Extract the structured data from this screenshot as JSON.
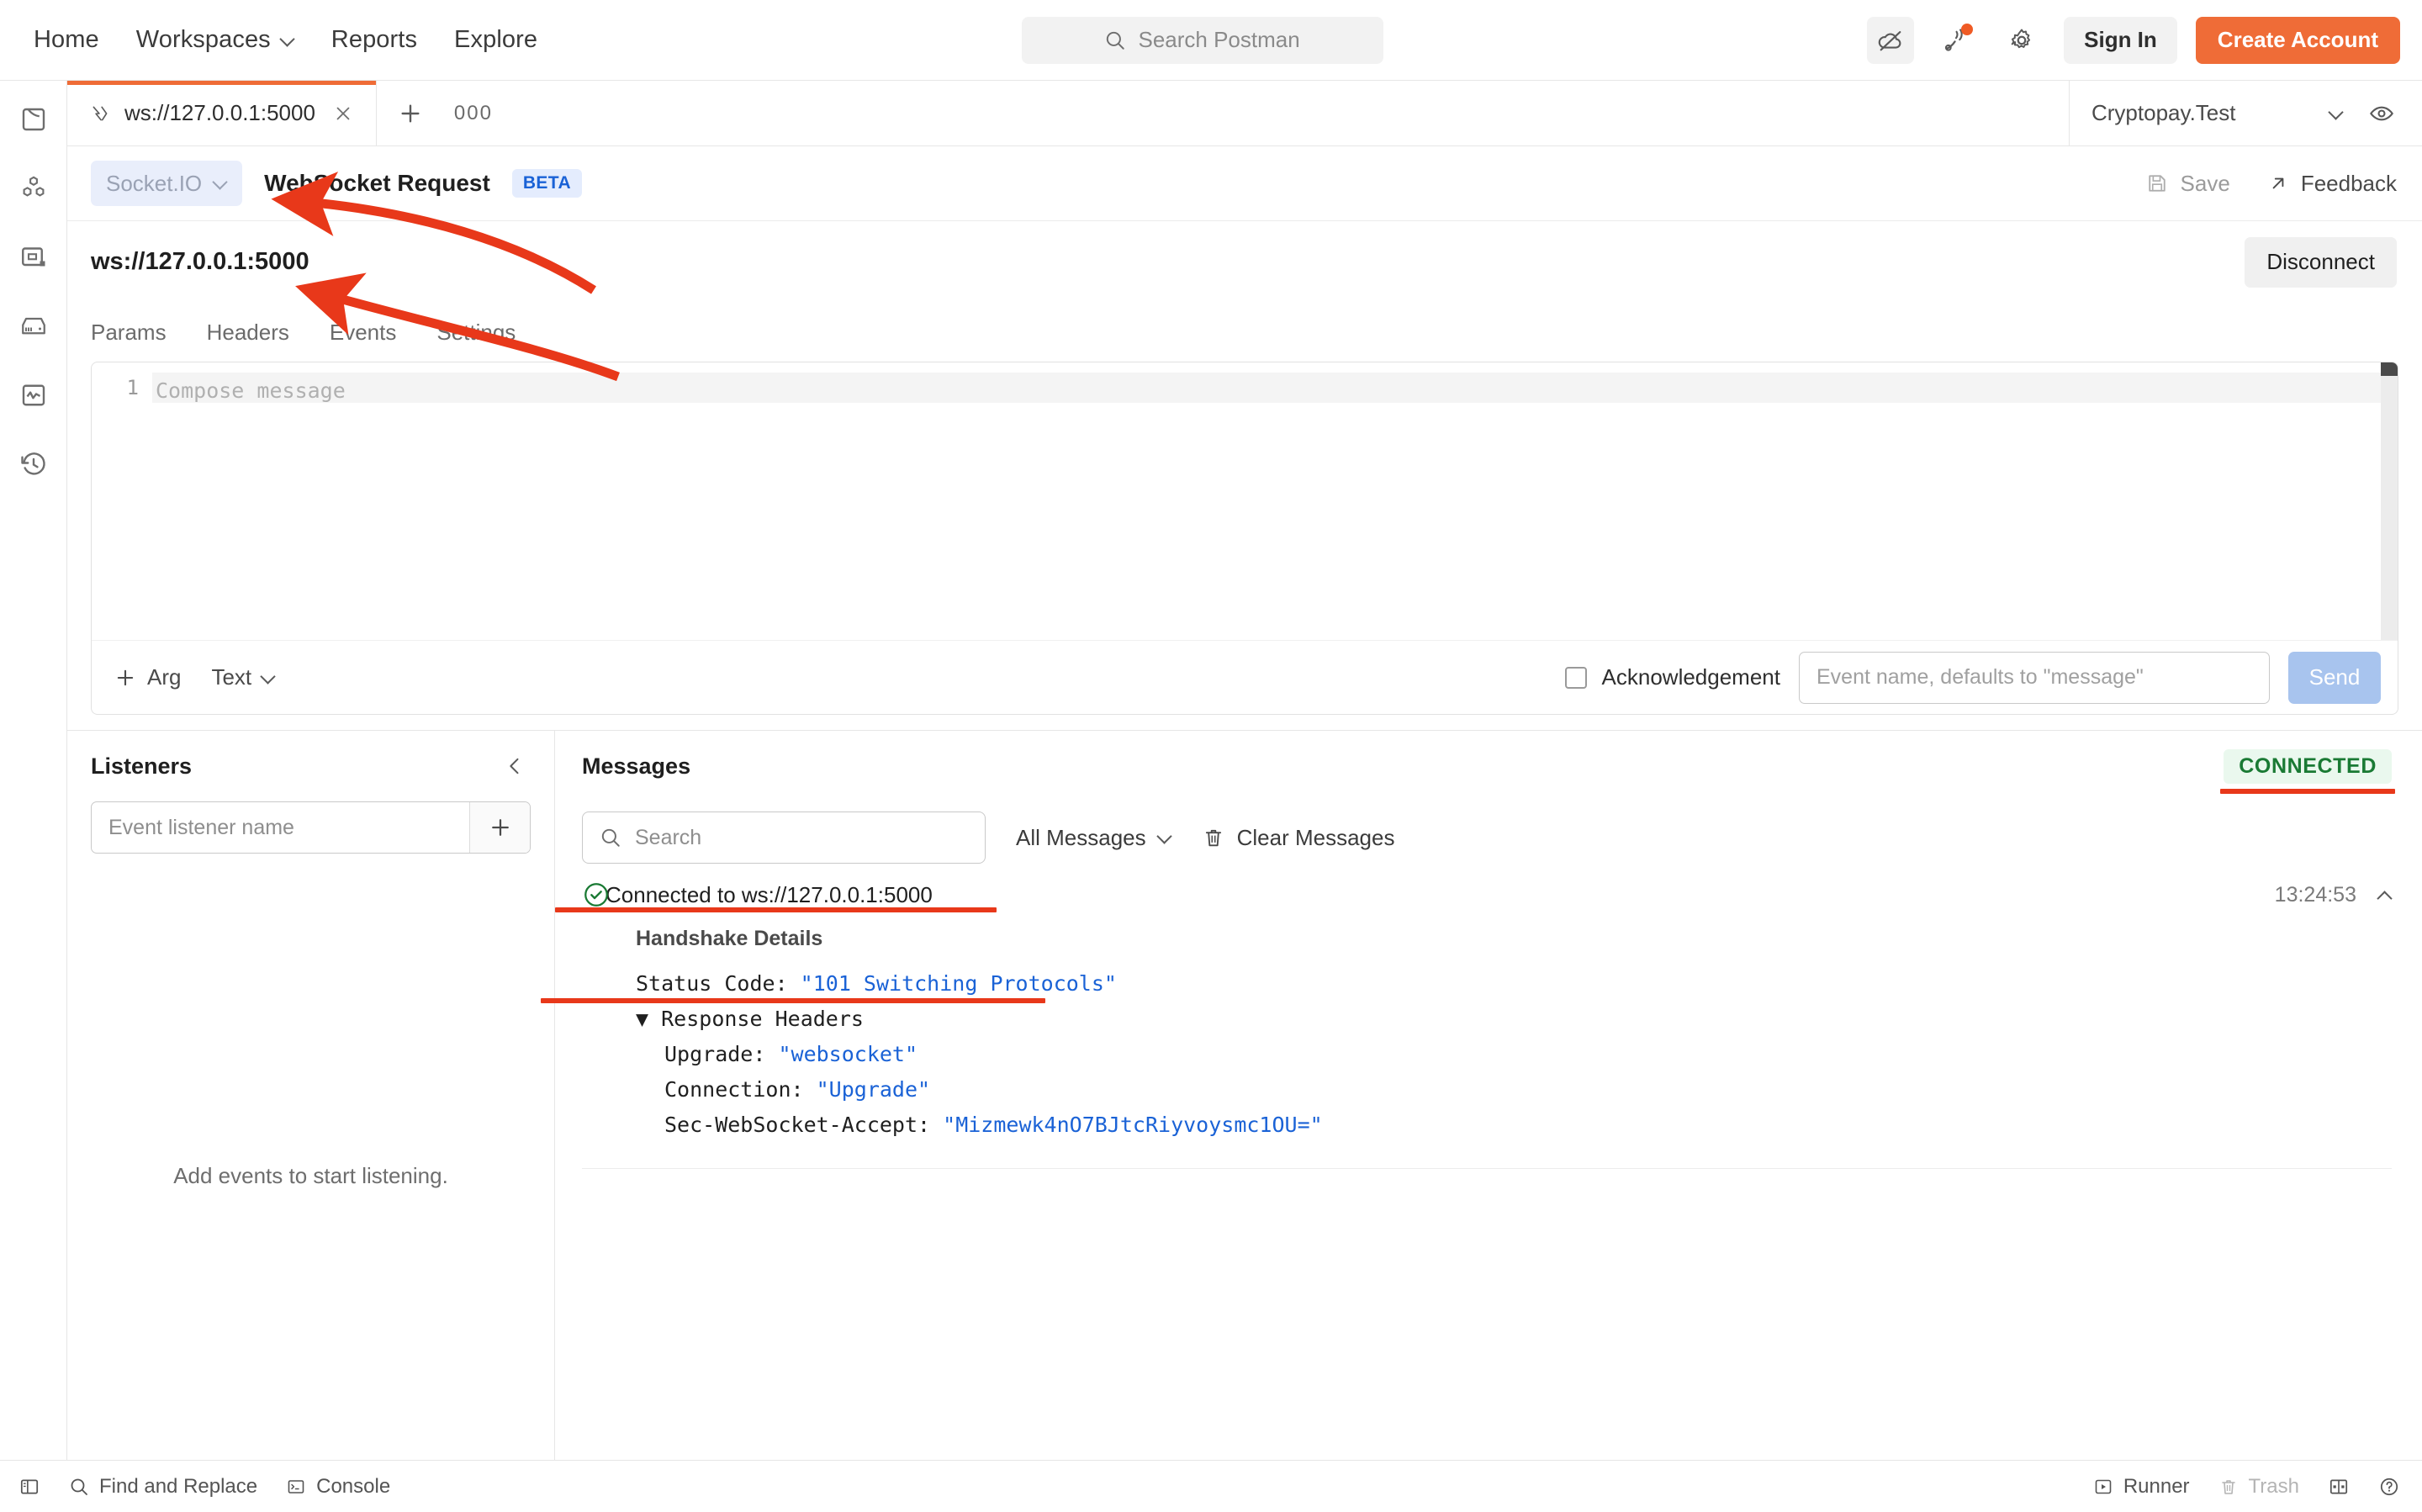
{
  "header": {
    "nav": [
      {
        "label": "Home",
        "has_caret": false
      },
      {
        "label": "Workspaces",
        "has_caret": true
      },
      {
        "label": "Reports",
        "has_caret": false
      },
      {
        "label": "Explore",
        "has_caret": false
      }
    ],
    "search_placeholder": "Search Postman",
    "icons": [
      "cloud-offline-icon",
      "satellite-icon",
      "gear-icon"
    ],
    "sign_in_label": "Sign In",
    "create_account_label": "Create Account",
    "accent_color": "#ef6c37"
  },
  "sidebar_rail": {
    "items": [
      {
        "icon": "collections-icon"
      },
      {
        "icon": "apis-icon"
      },
      {
        "icon": "environments-icon"
      },
      {
        "icon": "mock-servers-icon"
      },
      {
        "icon": "monitors-icon"
      },
      {
        "icon": "history-icon"
      }
    ]
  },
  "tabstrip": {
    "tabs": [
      {
        "label": "ws://127.0.0.1:5000",
        "icon": "websocket-icon",
        "active": true
      }
    ],
    "new_tab_label": "+",
    "more_label": "000",
    "environment": {
      "name": "Cryptopay.Test",
      "eye_icon": "eye-icon"
    }
  },
  "request": {
    "protocol_label": "Socket.IO",
    "title": "WebSocket Request",
    "beta_badge": "BETA",
    "save_label": "Save",
    "feedback_label": "Feedback",
    "url": "ws://127.0.0.1:5000",
    "disconnect_label": "Disconnect",
    "tabs": [
      "Params",
      "Headers",
      "Events",
      "Settings"
    ]
  },
  "composer": {
    "line_number": "1",
    "placeholder": "Compose message",
    "add_arg_label": "Arg",
    "format_label": "Text",
    "acknowledgement_label": "Acknowledgement",
    "acknowledgement_checked": false,
    "event_name_placeholder": "Event name, defaults to \"message\"",
    "send_label": "Send"
  },
  "listeners": {
    "title": "Listeners",
    "input_placeholder": "Event listener name",
    "add_label": "+",
    "empty_text": "Add events to start listening."
  },
  "messages": {
    "title": "Messages",
    "status_badge": "CONNECTED",
    "search_placeholder": "Search",
    "filter_label": "All Messages",
    "clear_label": "Clear Messages",
    "items": [
      {
        "status_icon": "check-circle-icon",
        "text": "Connected to ws://127.0.0.1:5000",
        "time": "13:24:53",
        "expanded": true,
        "handshake_title": "Handshake Details",
        "status_code_key": "Status Code: ",
        "status_code_value": "\"101 Switching Protocols\"",
        "response_headers_label": "Response Headers",
        "headers": [
          {
            "key": "Upgrade: ",
            "value": "\"websocket\""
          },
          {
            "key": "Connection: ",
            "value": "\"Upgrade\""
          },
          {
            "key": "Sec-WebSocket-Accept: ",
            "value": "\"Mizmewk4nO7BJtcRiyvoysmc1OU=\""
          }
        ]
      }
    ]
  },
  "statusbar": {
    "left": [
      {
        "label": "",
        "icon": "sidebar-toggle-icon"
      },
      {
        "label": "Find and Replace",
        "icon": "search-icon"
      },
      {
        "label": "Console",
        "icon": "console-icon"
      }
    ],
    "right": [
      {
        "label": "Runner",
        "icon": "runner-icon",
        "dim": false
      },
      {
        "label": "Trash",
        "icon": "trash-icon",
        "dim": true
      },
      {
        "label": "",
        "icon": "layout-icon",
        "dim": false
      },
      {
        "label": "",
        "icon": "help-icon",
        "dim": false
      }
    ]
  },
  "annotations": {
    "color": "#e8381a",
    "arrows": [
      {
        "name": "arrow-to-protocol-selector"
      },
      {
        "name": "arrow-to-url"
      }
    ],
    "underlines": [
      {
        "name": "underline-connected-message"
      },
      {
        "name": "underline-status-code"
      },
      {
        "name": "underline-connected-badge"
      }
    ]
  }
}
